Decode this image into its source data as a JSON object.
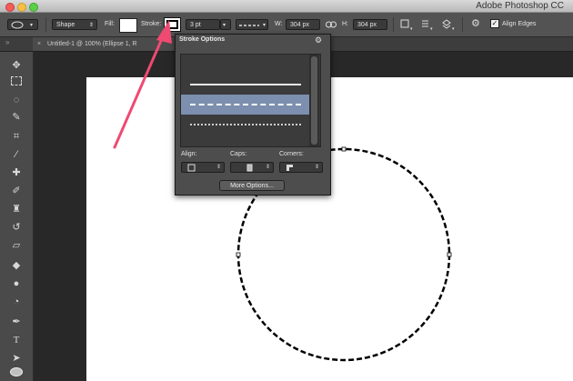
{
  "app": {
    "title": "Adobe Photoshop CC"
  },
  "options_bar": {
    "tool_mode": "Shape",
    "fill_label": "Fill:",
    "stroke_label": "Stroke:",
    "stroke_width": "3 pt",
    "width_label": "W:",
    "width_value": "304 px",
    "height_label": "H:",
    "height_value": "304 px",
    "align_edges_label": "Align Edges",
    "align_edges_checked": true
  },
  "document_tab": {
    "title": "Untitled-1 @ 100% (Ellipse 1, R",
    "suffix": "/8"
  },
  "stroke_options": {
    "title": "Stroke Options",
    "presets": [
      {
        "style": "solid",
        "selected": false
      },
      {
        "style": "dashed",
        "selected": true
      },
      {
        "style": "dotted",
        "selected": false
      }
    ],
    "align_label": "Align:",
    "caps_label": "Caps:",
    "corners_label": "Corners:",
    "more_options": "More Options..."
  },
  "colors": {
    "selection": "#7c8fae",
    "arrow": "#ee4a72",
    "ui_dark": "#4d4d4d"
  },
  "icons": [
    "apple-menu-icon",
    "ellipse-tool-icon",
    "stroke-swatch-icon",
    "link-icon",
    "gear-icon",
    "path-ops-icon",
    "path-align-icon",
    "path-arrange-icon"
  ]
}
